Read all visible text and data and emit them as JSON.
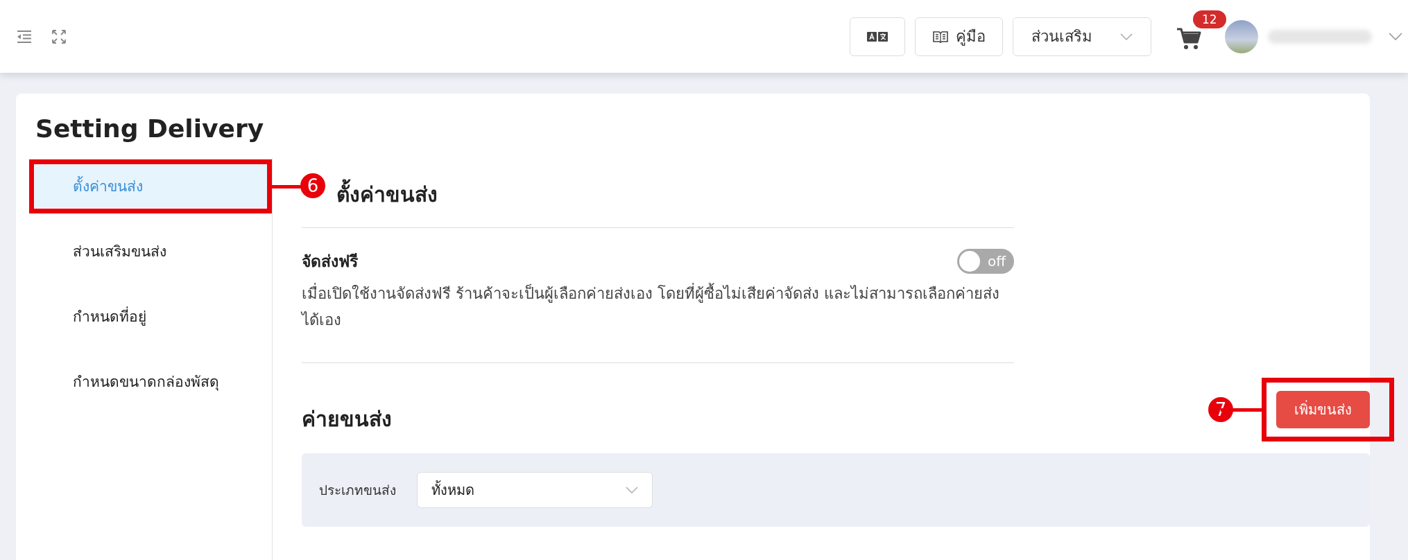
{
  "topbar": {
    "manual_button": {
      "label": "คู่มือ"
    },
    "addons_dropdown": {
      "label": "ส่วนเสริม"
    },
    "cart": {
      "badge": "12"
    }
  },
  "page": {
    "title": "Setting Delivery"
  },
  "sidebar": {
    "items": [
      {
        "label": "ตั้งค่าขนส่ง",
        "selected": true,
        "callout": "6"
      },
      {
        "label": "ส่วนเสริมขนส่ง",
        "selected": false
      },
      {
        "label": "กำหนดที่อยู่",
        "selected": false
      },
      {
        "label": "กำหนดขนาดกล่องพัสดุ",
        "selected": false
      }
    ]
  },
  "content": {
    "heading": "ตั้งค่าขนส่ง",
    "free_shipping": {
      "title": "จัดส่งฟรี",
      "on": false,
      "toggle_label": "off",
      "description": "เมื่อเปิดใช้งานจัดส่งฟรี ร้านค้าจะเป็นผู้เลือกค่ายส่งเอง โดยที่ผู้ซื้อไม่เสียค่าจัดส่ง และไม่สามารถเลือกค่ายส่งได้เอง"
    },
    "carriers": {
      "heading": "ค่ายขนส่ง",
      "add_button": {
        "label": "เพิ่มขนส่ง",
        "callout": "7"
      },
      "filter": {
        "label": "ประเภทขนส่ง",
        "value": "ทั้งหมด"
      }
    }
  }
}
